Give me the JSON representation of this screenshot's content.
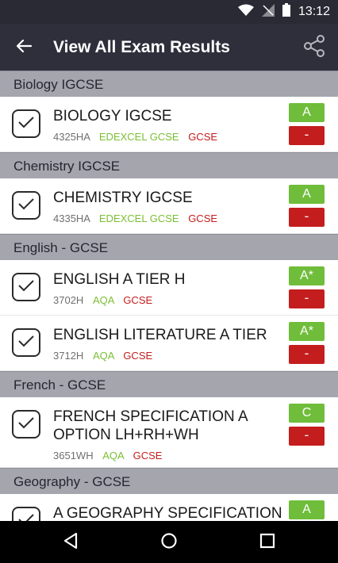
{
  "status_bar": {
    "time": "13:12"
  },
  "toolbar": {
    "title": "View All Exam Results"
  },
  "sections": [
    {
      "header": "Biology IGCSE",
      "rows": [
        {
          "title": "BIOLOGY IGCSE",
          "code": "4325HA",
          "board": "EDEXCEL GCSE",
          "level": "GCSE",
          "grade": "A",
          "minus": "-"
        }
      ]
    },
    {
      "header": "Chemistry IGCSE",
      "rows": [
        {
          "title": "CHEMISTRY IGCSE",
          "code": "4335HA",
          "board": "EDEXCEL GCSE",
          "level": "GCSE",
          "grade": "A",
          "minus": "-"
        }
      ]
    },
    {
      "header": "English - GCSE",
      "rows": [
        {
          "title": "ENGLISH A TIER H",
          "code": "3702H",
          "board": "AQA",
          "level": "GCSE",
          "grade": "A*",
          "minus": "-"
        },
        {
          "title": "ENGLISH LITERATURE A TIER",
          "code": "3712H",
          "board": "AQA",
          "level": "GCSE",
          "grade": "A*",
          "minus": "-"
        }
      ]
    },
    {
      "header": "French - GCSE",
      "rows": [
        {
          "title": "FRENCH SPECIFICATION A OPTION LH+RH+WH",
          "code": "3651WH",
          "board": "AQA",
          "level": "GCSE",
          "grade": "C",
          "minus": "-"
        }
      ]
    },
    {
      "header": "Geography - GCSE",
      "rows": [
        {
          "title": "A GEOGRAPHY SPECIFICATION",
          "code": "",
          "board": "",
          "level": "",
          "grade": "A",
          "minus": "-"
        }
      ]
    }
  ],
  "colors": {
    "toolbar": "#2f2f3c",
    "section_header": "#a5a5ae",
    "grade_green": "#6fbd3a",
    "minus_red": "#c41d1d",
    "board_green": "#7bbf33",
    "level_red": "#c41d1d"
  },
  "icons": {
    "back": "arrow-left-icon",
    "share": "share-icon",
    "check": "checkmark-icon",
    "nav_back": "triangle-back-icon",
    "nav_home": "circle-home-icon",
    "nav_recents": "square-recents-icon"
  }
}
